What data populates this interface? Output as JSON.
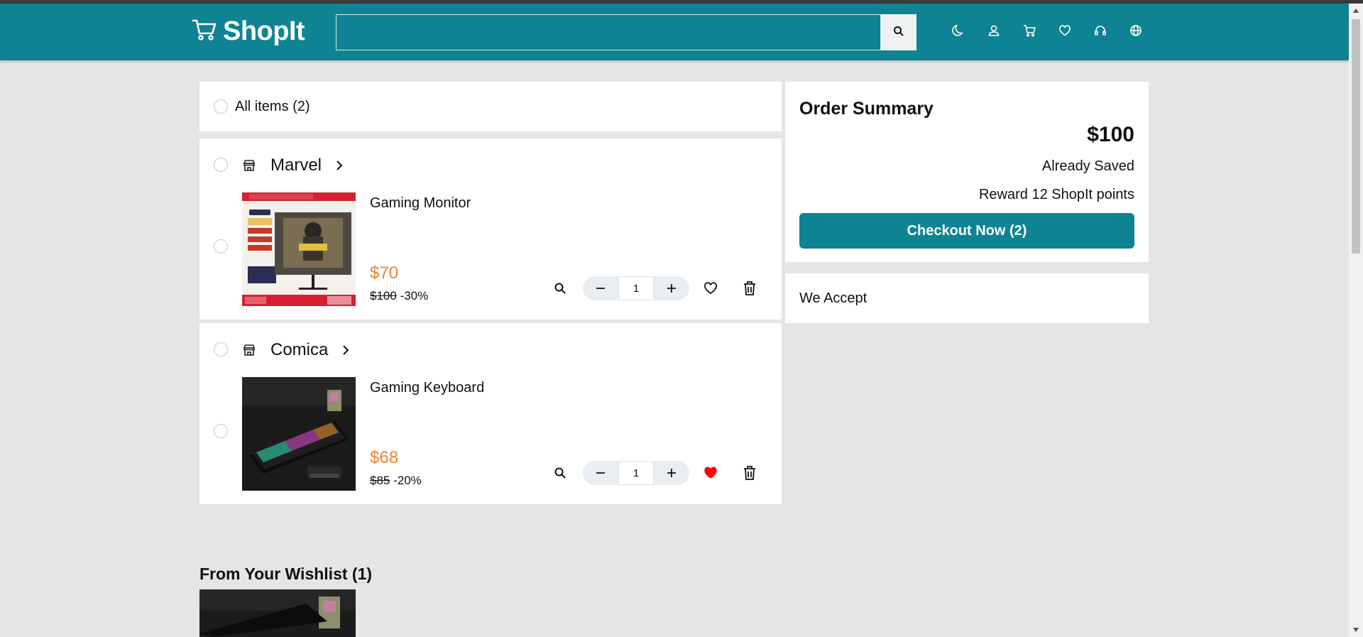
{
  "header": {
    "brand": "ShopIt",
    "search_placeholder": "",
    "icons": [
      "moon-icon",
      "user-icon",
      "cart-icon",
      "heart-icon",
      "headset-icon",
      "globe-icon"
    ]
  },
  "cart": {
    "all_items_label": "All items (2)",
    "stores": [
      {
        "name": "Marvel",
        "item": {
          "title": "Gaming Monitor",
          "price": "$70",
          "old_price": "$100",
          "discount": "-30%",
          "quantity": "1",
          "wishlisted": false
        }
      },
      {
        "name": "Comica",
        "item": {
          "title": "Gaming Keyboard",
          "price": "$68",
          "old_price": "$85",
          "discount": "-20%",
          "quantity": "1",
          "wishlisted": true
        }
      }
    ]
  },
  "summary": {
    "title": "Order Summary",
    "total": "$100",
    "saved_label": "Already Saved",
    "reward_label": "Reward 12 ShopIt points",
    "checkout_label": "Checkout Now (2)"
  },
  "payments": {
    "label": "We Accept"
  },
  "wishlist": {
    "title": "From Your Wishlist (1)"
  },
  "colors": {
    "brand": "#0e8393",
    "price": "#f08234",
    "heart_active": "#ff0000",
    "background": "#e5e5e5"
  }
}
